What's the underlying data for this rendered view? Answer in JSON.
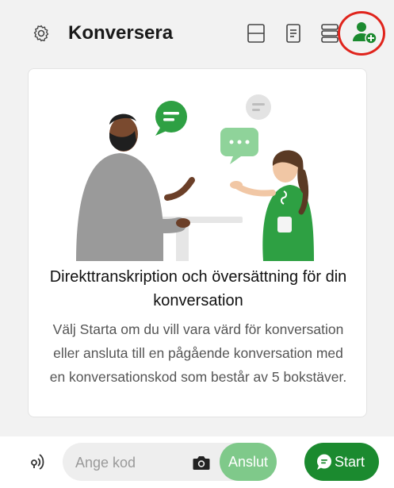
{
  "header": {
    "title": "Konversera"
  },
  "card": {
    "heading": "Direkttranskription och översättning för din konversation",
    "description": "Välj Starta om du vill vara värd för konversation eller ansluta till en pågående konversation med en konversationskod som består av 5 bokstäver."
  },
  "bottom": {
    "code_placeholder": "Ange kod",
    "join_label": "Anslut",
    "start_label": "Start"
  },
  "icons": {
    "settings": "gear-icon",
    "split_view": "split-view-icon",
    "document": "document-icon",
    "list_view": "list-view-icon",
    "add_person": "add-person-icon",
    "proximity": "proximity-icon",
    "camera": "camera-icon",
    "chat": "chat-bubble-icon"
  },
  "colors": {
    "brand_green": "#1b8a2f",
    "join_green": "#7fc98a",
    "highlight_red": "#e0241c"
  }
}
